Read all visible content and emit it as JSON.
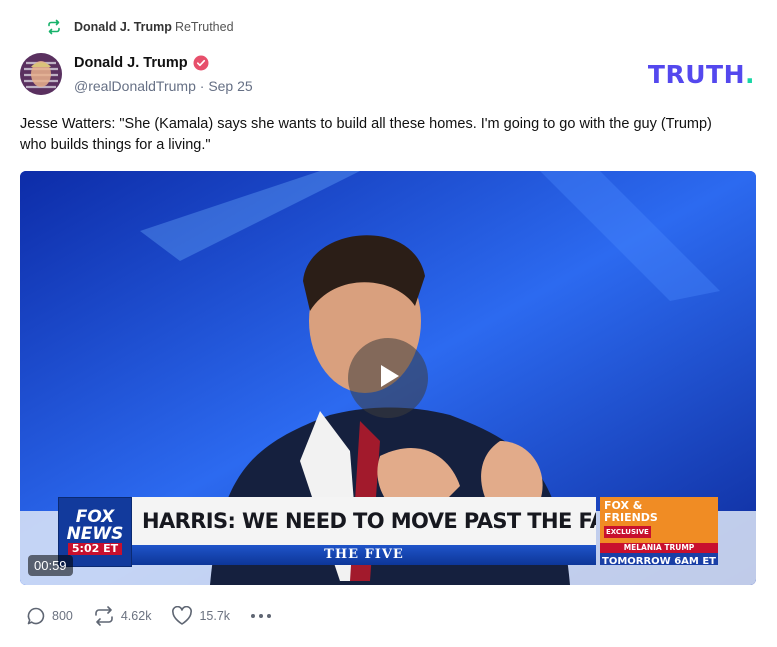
{
  "retruth": {
    "user": "Donald J. Trump",
    "label": "ReTruthed"
  },
  "post": {
    "display_name": "Donald J. Trump",
    "handle": "@realDonaldTrump",
    "date": "Sep 25",
    "text": "Jesse Watters: \"She (Kamala) says she wants to build all these homes. I'm going to go with the guy (Trump) who builds things for a living.\""
  },
  "logo": {
    "text": "TRUTH",
    "dot": "."
  },
  "video": {
    "duration": "00:59",
    "chyron": {
      "network_line1": "FOX",
      "network_line2": "NEWS",
      "time": "5:02 ET",
      "headline": "HARRIS: WE NEED TO MOVE PAST THE FAILED POLICIES",
      "show": "THE FIVE",
      "promo_line1": "FOX &",
      "promo_line2": "FRIENDS",
      "promo_exclusive": "EXCLUSIVE",
      "promo_guest": "MELANIA TRUMP",
      "promo_time": "TOMORROW 6AM ET"
    }
  },
  "stats": {
    "replies": "800",
    "retruths": "4.62k",
    "likes": "15.7k"
  },
  "icons": {
    "retruth": "retruth-icon",
    "verified": "verified-badge-icon",
    "reply": "reply-icon",
    "like": "heart-icon",
    "more": "more-icon",
    "play": "play-icon"
  },
  "colors": {
    "brand": "#5448ee",
    "brand_dot": "#17d6a6",
    "retruth_green": "#17b26a",
    "verified": "#e74f6b"
  }
}
